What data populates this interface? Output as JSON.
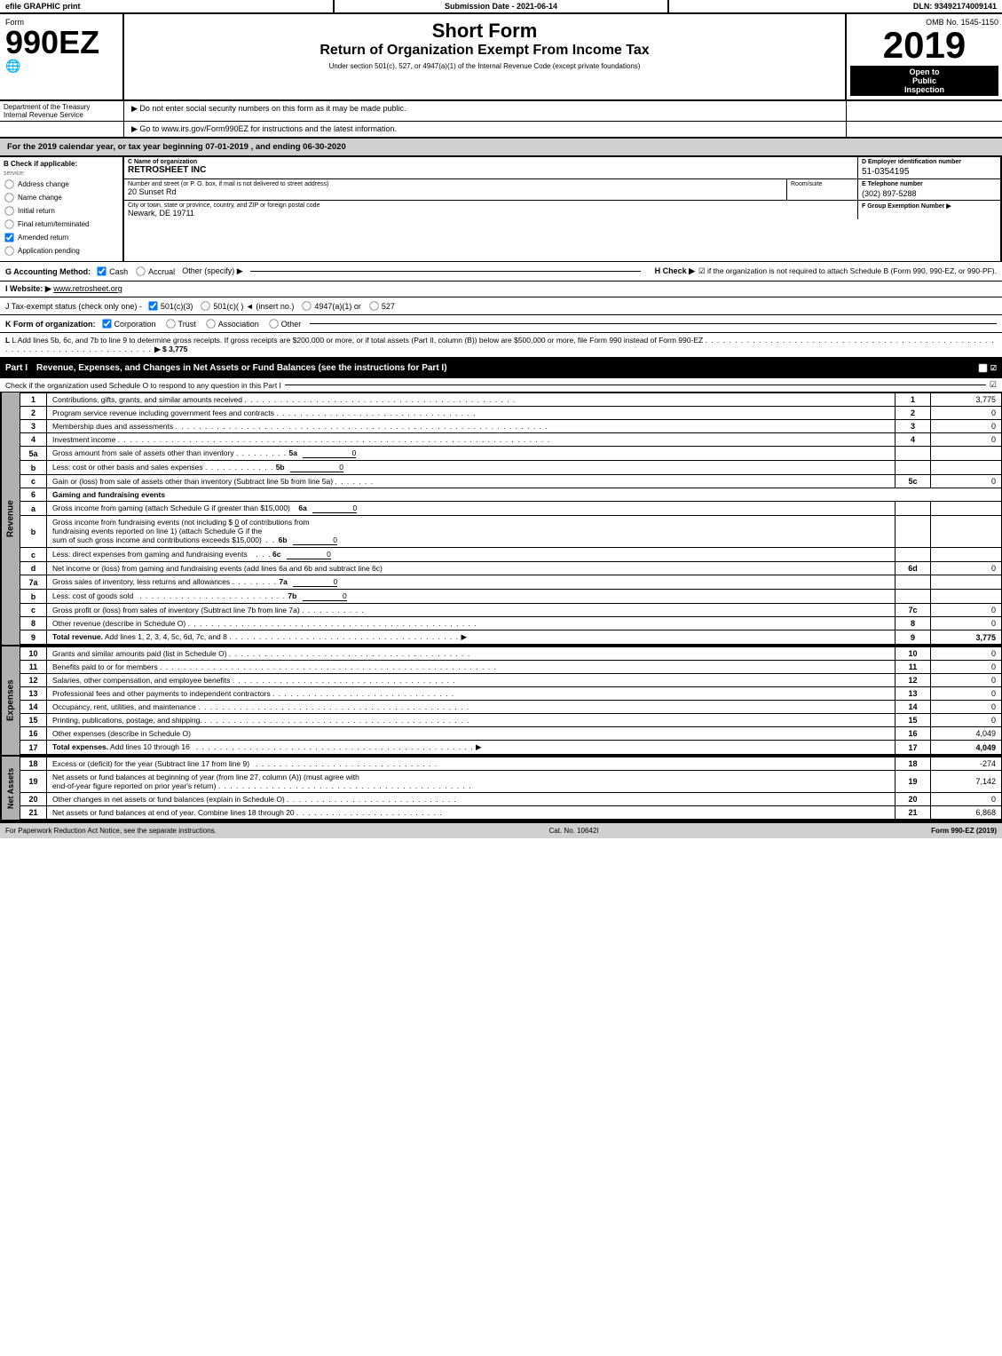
{
  "topbar": {
    "efile": "efile GRAPHIC print",
    "submission": "Submission Date - 2021-06-14",
    "dln": "DLN: 93492174009141"
  },
  "header": {
    "form_number": "990EZ",
    "form_label": "Form",
    "form_sub": "OMB No. 1545-1150",
    "title_main": "Short Form",
    "title_sub": "Return of Organization Exempt From Income Tax",
    "title_note": "Under section 501(c), 527, or 4947(a)(1) of the Internal Revenue Code (except private foundations)",
    "note1": "▶ Do not enter social security numbers on this form as it may be made public.",
    "note2": "▶ Go to www.irs.gov/Form990EZ for instructions and the latest information.",
    "year": "2019",
    "open_to": "Open to",
    "public": "Public",
    "inspection": "Inspection"
  },
  "dept": {
    "name": "Department of the Treasury",
    "sub": "Internal Revenue Service"
  },
  "taxyear": {
    "text": "For the 2019 calendar year, or tax year beginning 07-01-2019 , and ending 06-30-2020"
  },
  "checks": {
    "label_b": "B Check if applicable:",
    "address_change": "Address change",
    "name_change": "Name change",
    "initial_return": "Initial return",
    "final_return": "Final return/terminated",
    "amended_return": "Amended return",
    "application_pending": "Application pending",
    "amended_checked": true
  },
  "org": {
    "name_label": "C Name of organization",
    "name": "RETROSHEET INC",
    "address_label": "Number and street (or P. O. box, if mail is not delivered to street address)",
    "address": "20 Sunset Rd",
    "room_label": "Room/suite",
    "city_label": "City or town, state or province, country, and ZIP or foreign postal code",
    "city": "Newark, DE  19711",
    "phone_label": "E Telephone number",
    "phone": "(302) 897-5288",
    "group_label": "F Group Exemption Number",
    "ein_label": "D Employer identification number",
    "ein": "51-0354195"
  },
  "accounting": {
    "label_g": "G Accounting Method:",
    "cash": "Cash",
    "accrual": "Accrual",
    "other": "Other (specify) ▶",
    "cash_checked": true,
    "label_h": "H  Check ▶",
    "h_text": "☑ if the organization is not required to attach Schedule B (Form 990, 990-EZ, or 990-PF)."
  },
  "website": {
    "label": "I Website: ▶",
    "url": "www.retrosheet.org"
  },
  "taxstatus": {
    "label": "J Tax-exempt status (check only one) -",
    "options": [
      "501(c)(3)",
      "501(c)(  ) ◄ (insert no.)",
      "4947(a)(1) or",
      "527"
    ],
    "checked": "501(c)(3)"
  },
  "formorg": {
    "label": "K Form of organization:",
    "options": [
      "Corporation",
      "Trust",
      "Association",
      "Other"
    ],
    "checked": "Corporation"
  },
  "addlines": {
    "text": "L Add lines 5b, 6c, and 7b to line 9 to determine gross receipts. If gross receipts are $200,000 or more, or if total assets (Part II, column (B)) below are $500,000 or more, file Form 990 instead of Form 990-EZ",
    "amount": "▶ $ 3,775"
  },
  "part1": {
    "label": "Part I",
    "title": "Revenue, Expenses, and Changes in Net Assets or Fund Balances (see the instructions for Part I)",
    "check_text": "Check if the organization used Schedule O to respond to any question in this Part I",
    "lines": [
      {
        "num": "1",
        "desc": "Contributions, gifts, grants, and similar amounts received",
        "col_num": "1",
        "amount": "3,775"
      },
      {
        "num": "2",
        "desc": "Program service revenue including government fees and contracts",
        "col_num": "2",
        "amount": "0"
      },
      {
        "num": "3",
        "desc": "Membership dues and assessments",
        "col_num": "3",
        "amount": "0"
      },
      {
        "num": "4",
        "desc": "Investment income",
        "col_num": "4",
        "amount": "0"
      }
    ]
  },
  "line5a": {
    "num": "5a",
    "desc": "Gross amount from sale of assets other than inventory",
    "col": "5a",
    "val": "0"
  },
  "line5b": {
    "num": "b",
    "desc": "Less: cost or other basis and sales expenses",
    "col": "5b",
    "val": "0"
  },
  "line5c": {
    "num": "c",
    "desc": "Gain or (loss) from sale of assets other than inventory (Subtract line 5b from line 5a)",
    "col_num": "5c",
    "amount": "0"
  },
  "line6": {
    "num": "6",
    "desc": "Gaming and fundraising events"
  },
  "line6a": {
    "num": "a",
    "desc": "Gross income from gaming (attach Schedule G if greater than $15,000)",
    "col": "6a",
    "val": "0"
  },
  "line6b_text": "Gross income from fundraising events (not including $ 0 of contributions from fundraising events reported on line 1) (attach Schedule G if the sum of such gross income and contributions exceeds $15,000)",
  "line6b_col": "6b",
  "line6b_val": "0",
  "line6c": {
    "num": "c",
    "desc": "Less: direct expenses from gaming and fundraising events",
    "col": "6c",
    "val": "0"
  },
  "line6d": {
    "num": "d",
    "desc": "Net income or (loss) from gaming and fundraising events (add lines 6a and 6b and subtract line 6c)",
    "col_num": "6d",
    "amount": "0"
  },
  "line7a": {
    "num": "7a",
    "desc": "Gross sales of inventory, less returns and allowances",
    "col": "7a",
    "val": "0"
  },
  "line7b": {
    "num": "b",
    "desc": "Less: cost of goods sold",
    "col": "7b",
    "val": "0"
  },
  "line7c": {
    "num": "c",
    "desc": "Gross profit or (loss) from sales of inventory (Subtract line 7b from line 7a)",
    "col_num": "7c",
    "amount": "0"
  },
  "line8": {
    "num": "8",
    "desc": "Other revenue (describe in Schedule O)",
    "col_num": "8",
    "amount": "0"
  },
  "line9": {
    "num": "9",
    "desc": "Total revenue. Add lines 1, 2, 3, 4, 5c, 6d, 7c, and 8",
    "col_num": "9",
    "amount": "3,775"
  },
  "expenses": {
    "lines": [
      {
        "num": "10",
        "desc": "Grants and similar amounts paid (list in Schedule O)",
        "col_num": "10",
        "amount": "0"
      },
      {
        "num": "11",
        "desc": "Benefits paid to or for members",
        "col_num": "11",
        "amount": "0"
      },
      {
        "num": "12",
        "desc": "Salaries, other compensation, and employee benefits",
        "col_num": "12",
        "amount": "0"
      },
      {
        "num": "13",
        "desc": "Professional fees and other payments to independent contractors",
        "col_num": "13",
        "amount": "0"
      },
      {
        "num": "14",
        "desc": "Occupancy, rent, utilities, and maintenance",
        "col_num": "14",
        "amount": "0"
      },
      {
        "num": "15",
        "desc": "Printing, publications, postage, and shipping.",
        "col_num": "15",
        "amount": "0"
      },
      {
        "num": "16",
        "desc": "Other expenses (describe in Schedule O)",
        "col_num": "16",
        "amount": "4,049"
      },
      {
        "num": "17",
        "desc": "Total expenses. Add lines 10 through 16",
        "col_num": "17",
        "amount": "4,049",
        "bold": true
      }
    ]
  },
  "netassets": {
    "lines": [
      {
        "num": "18",
        "desc": "Excess or (deficit) for the year (Subtract line 17 from line 9)",
        "col_num": "18",
        "amount": "-274"
      },
      {
        "num": "19",
        "desc": "Net assets or fund balances at beginning of year (from line 27, column (A)) (must agree with end-of-year figure reported on prior year's return)",
        "col_num": "19",
        "amount": "7,142"
      },
      {
        "num": "20",
        "desc": "Other changes in net assets or fund balances (explain in Schedule O)",
        "col_num": "20",
        "amount": "0"
      },
      {
        "num": "21",
        "desc": "Net assets or fund balances at end of year. Combine lines 18 through 20",
        "col_num": "21",
        "amount": "6,868"
      }
    ]
  },
  "footer": {
    "paperwork": "For Paperwork Reduction Act Notice, see the separate instructions.",
    "cat": "Cat. No. 10642I",
    "form": "Form 990-EZ (2019)"
  }
}
